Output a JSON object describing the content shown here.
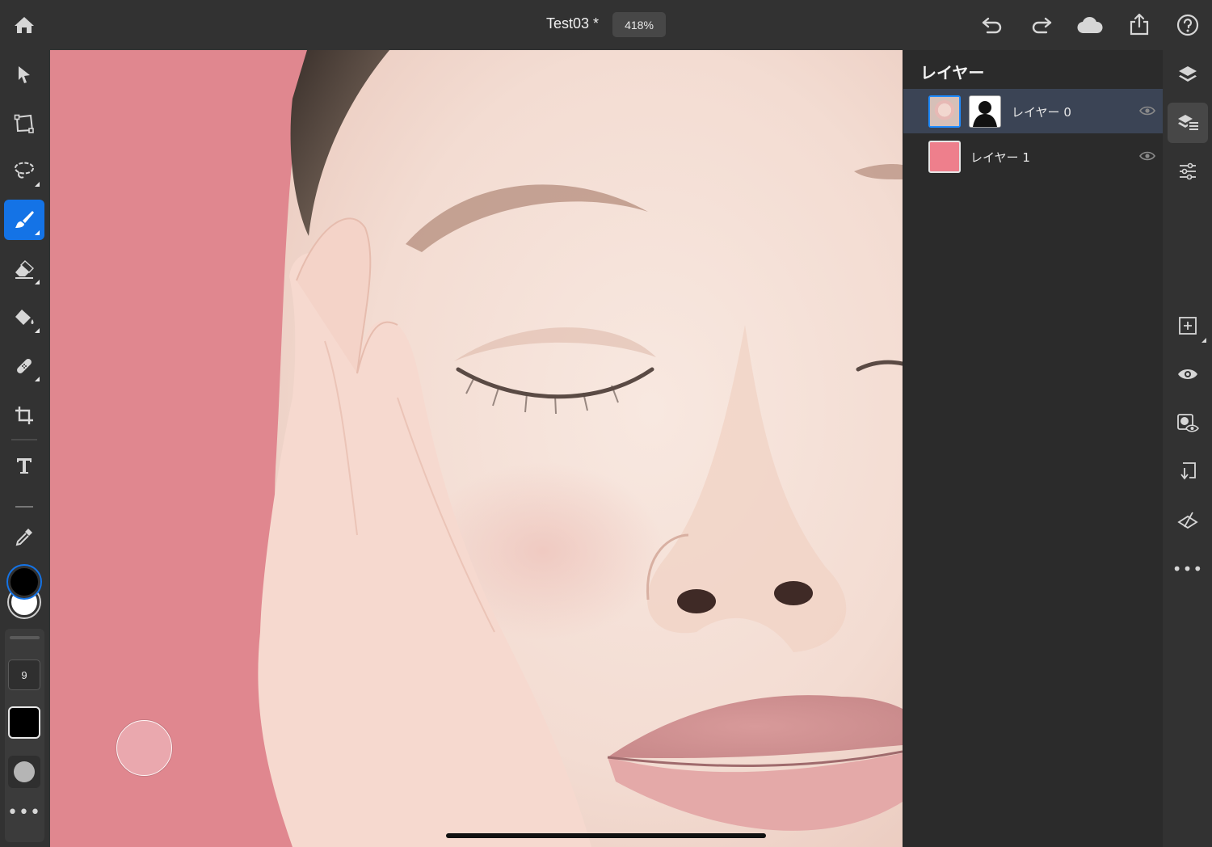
{
  "topbar": {
    "document_title": "Test03 *",
    "zoom_level": "418%",
    "icons": [
      "home-icon",
      "undo-icon",
      "redo-icon",
      "cloud-icon",
      "share-icon",
      "help-icon"
    ]
  },
  "tools": [
    {
      "name": "select-tool",
      "icon": "arrow-icon"
    },
    {
      "name": "transform-tool",
      "icon": "transform-icon"
    },
    {
      "name": "lasso-tool",
      "icon": "lasso-icon"
    },
    {
      "name": "brush-tool",
      "icon": "brush-icon",
      "active": true
    },
    {
      "name": "eraser-tool",
      "icon": "eraser-icon"
    },
    {
      "name": "fill-tool",
      "icon": "paint-bucket-icon"
    },
    {
      "name": "healing-tool",
      "icon": "bandage-icon"
    },
    {
      "name": "crop-tool",
      "icon": "crop-icon"
    },
    {
      "name": "type-tool",
      "icon": "type-icon"
    },
    {
      "name": "eyedropper-tool",
      "icon": "eyedropper-icon"
    }
  ],
  "brush_settings": {
    "size": "9",
    "primary_color": "#000000",
    "secondary_color": "#ffffff"
  },
  "canvas": {
    "background_color": "#e0878f",
    "brush_cursor_color": "#eaa8ae"
  },
  "layers_panel": {
    "title": "レイヤー",
    "layers": [
      {
        "name": "レイヤー 0",
        "selected": true,
        "visible": true,
        "has_mask": true
      },
      {
        "name": "レイヤー 1",
        "selected": false,
        "visible": true,
        "has_mask": false,
        "fill_color": "#ee7f8c"
      }
    ]
  },
  "right_toolbar": {
    "icons": [
      "layers-icon",
      "layer-properties-icon",
      "adjustments-icon",
      "add-layer-icon",
      "visibility-icon",
      "mask-icon",
      "merge-down-icon",
      "clear-icon",
      "more-icon"
    ]
  },
  "colors": {
    "accent": "#1473e6",
    "panel_bg": "#2b2b2b",
    "toolbar_bg": "#323232",
    "selected_row": "#3b4455"
  }
}
